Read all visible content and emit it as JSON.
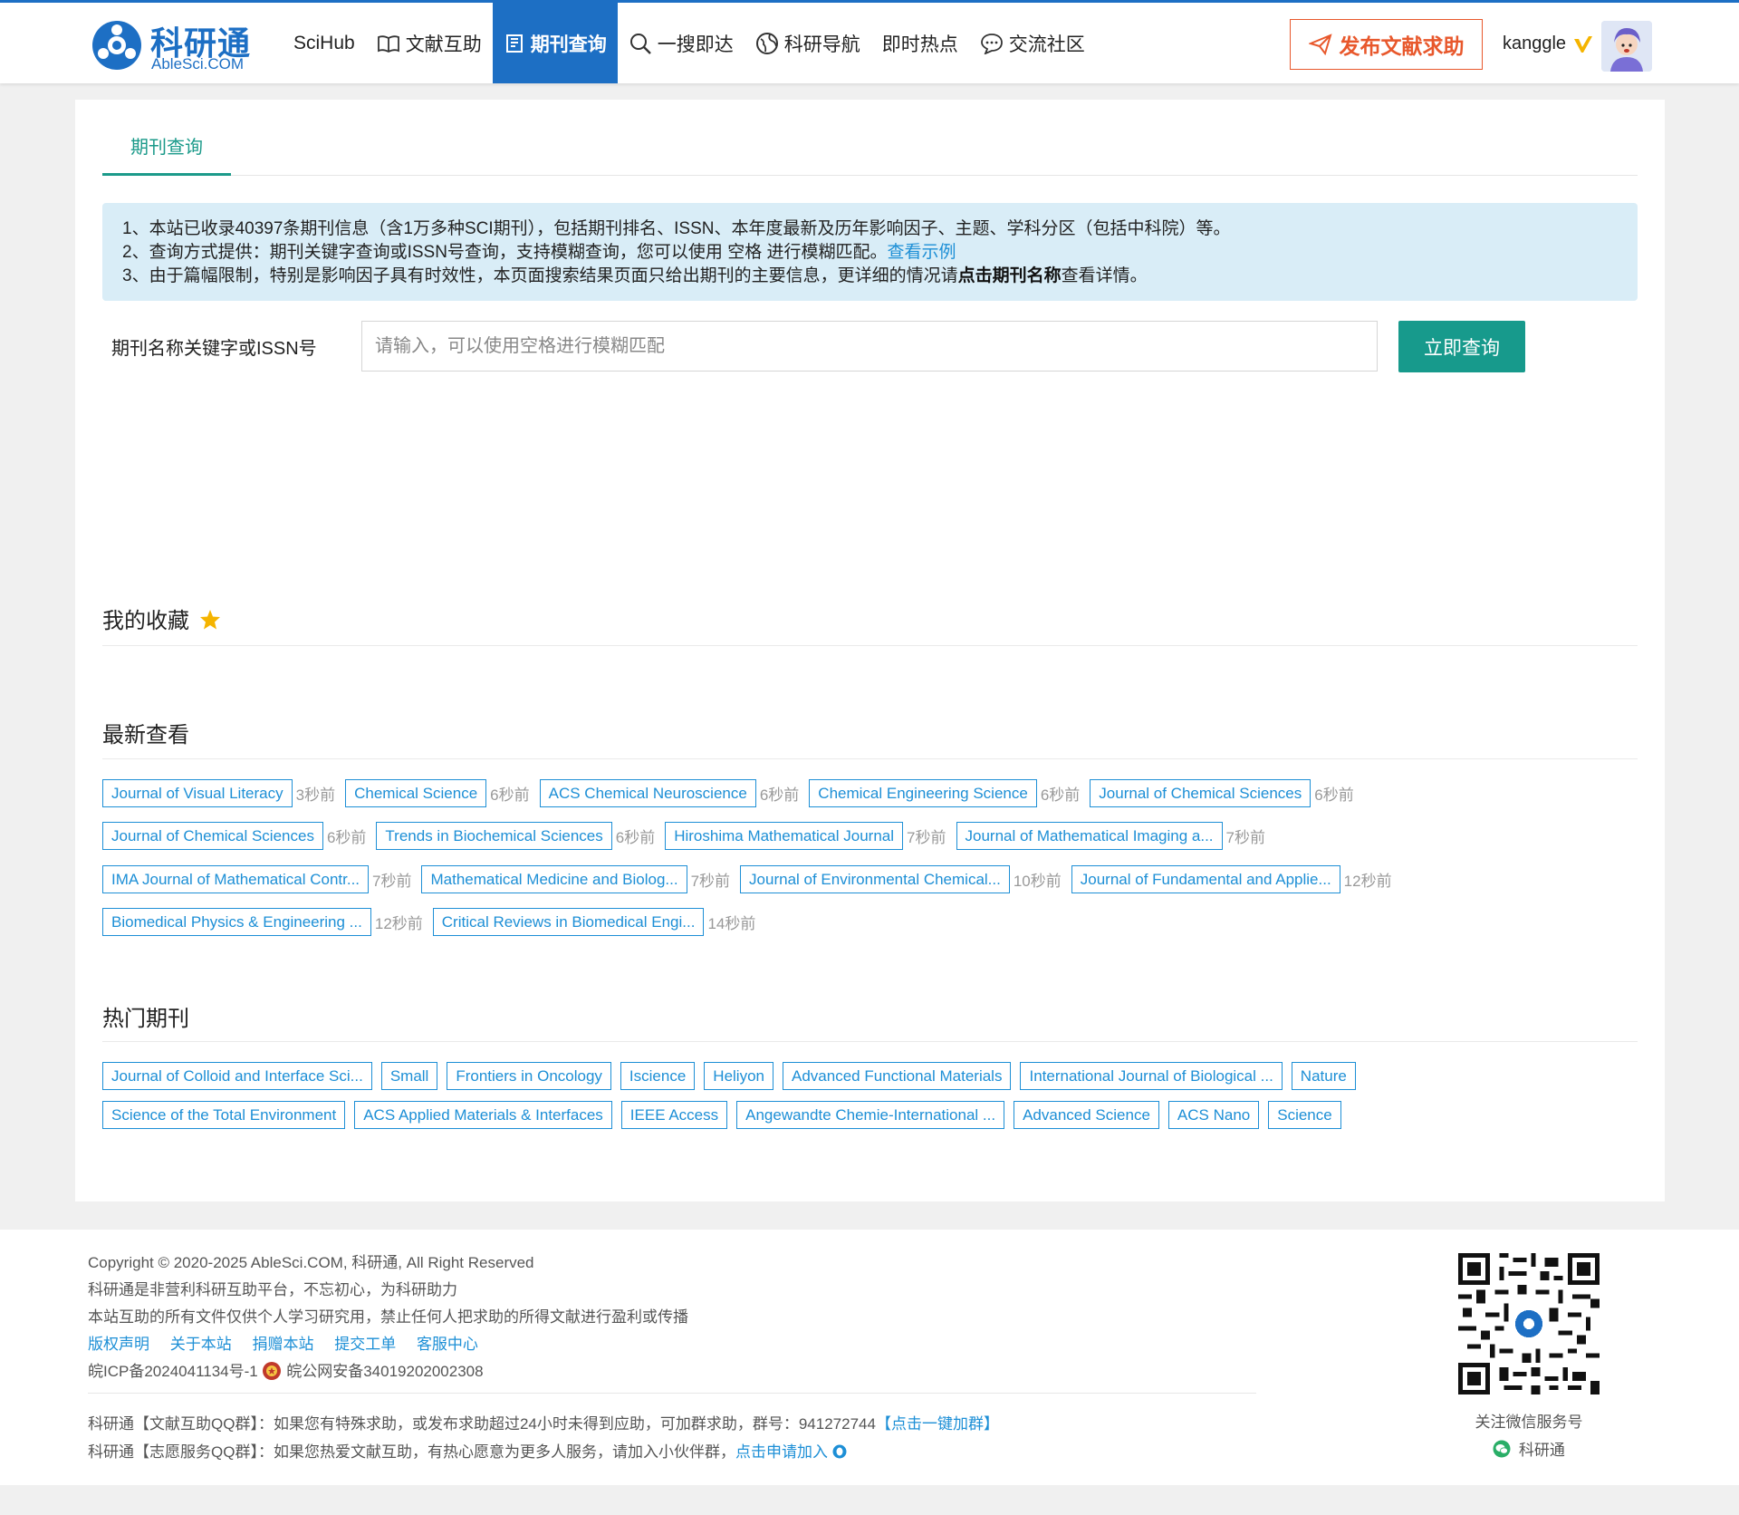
{
  "header": {
    "logo_cn": "科研通",
    "logo_en": "AbleSci.COM",
    "nav": [
      {
        "label": "SciHub",
        "icon": ""
      },
      {
        "label": "文献互助",
        "icon": "book-icon"
      },
      {
        "label": "期刊查询",
        "icon": "journal-icon",
        "active": true
      },
      {
        "label": "一搜即达",
        "icon": "search-icon"
      },
      {
        "label": "科研导航",
        "icon": "globe-icon"
      },
      {
        "label": "即时热点",
        "icon": ""
      },
      {
        "label": "交流社区",
        "icon": "chat-icon"
      }
    ],
    "post_button": "发布文献求助",
    "username": "kanggle"
  },
  "main": {
    "tab_label": "期刊查询",
    "notice": {
      "line1": "1、本站已收录40397条期刊信息（含1万多种SCI期刊），包括期刊排名、ISSN、本年度最新及历年影响因子、主题、学科分区（包括中科院）等。",
      "line2_text": "2、查询方式提供：期刊关键字查询或ISSN号查询，支持模糊查询，您可以使用 空格 进行模糊匹配。",
      "line2_link": "查看示例",
      "line3_text": "3、由于篇幅限制，特别是影响因子具有时效性，本页面搜索结果页面只给出期刊的主要信息，更详细的情况请",
      "line3_bold": "点击期刊名称",
      "line3_tail": "查看详情。"
    },
    "search": {
      "label": "期刊名称关键字或ISSN号",
      "placeholder": "请输入，可以使用空格进行模糊匹配",
      "button": "立即查询"
    },
    "favorites_title": "我的收藏",
    "recent_title": "最新查看",
    "recent": [
      [
        {
          "name": "Journal of Visual Literacy",
          "time": "3秒前"
        },
        {
          "name": "Chemical Science",
          "time": "6秒前"
        },
        {
          "name": "ACS Chemical Neuroscience",
          "time": "6秒前"
        },
        {
          "name": "Chemical Engineering Science",
          "time": "6秒前"
        },
        {
          "name": "Journal of Chemical Sciences",
          "time": "6秒前"
        }
      ],
      [
        {
          "name": "Journal of Chemical Sciences",
          "time": "6秒前"
        },
        {
          "name": "Trends in Biochemical Sciences",
          "time": "6秒前"
        },
        {
          "name": "Hiroshima Mathematical Journal",
          "time": "7秒前"
        },
        {
          "name": "Journal of Mathematical Imaging a...",
          "time": "7秒前"
        }
      ],
      [
        {
          "name": "IMA Journal of Mathematical Contr...",
          "time": "7秒前"
        },
        {
          "name": "Mathematical Medicine and Biolog...",
          "time": "7秒前"
        },
        {
          "name": "Journal of Environmental Chemical...",
          "time": "10秒前"
        },
        {
          "name": "Journal of Fundamental and Applie...",
          "time": "12秒前"
        }
      ],
      [
        {
          "name": "Biomedical Physics & Engineering ...",
          "time": "12秒前"
        },
        {
          "name": "Critical Reviews in Biomedical Engi...",
          "time": "14秒前"
        }
      ]
    ],
    "hot_title": "热门期刊",
    "hot": [
      [
        "Journal of Colloid and Interface Sci...",
        "Small",
        "Frontiers in Oncology",
        "Iscience",
        "Heliyon",
        "Advanced Functional Materials",
        "International Journal of Biological ...",
        "Nature"
      ],
      [
        "Science of the Total Environment",
        "ACS Applied Materials & Interfaces",
        "IEEE Access",
        "Angewandte Chemie-International ...",
        "Advanced Science",
        "ACS Nano",
        "Science"
      ]
    ]
  },
  "footer": {
    "copyright": "Copyright © 2020-2025 AbleSci.COM, 科研通, All Right Reserved",
    "slogan": "科研通是非营利科研互助平台，不忘初心，为科研助力",
    "disclaimer": "本站互助的所有文件仅供个人学习研究用，禁止任何人把求助的所得文献进行盈利或传播",
    "links": [
      "版权声明",
      "关于本站",
      "捐赠本站",
      "提交工单",
      "客服中心"
    ],
    "icp": "皖ICP备2024041134号-1",
    "police": "皖公网安备34019202002308",
    "qq1_text": "科研通【文献互助QQ群】：如果您有特殊求助，或发布求助超过24小时未得到应助，可加群求助，群号：941272744",
    "qq1_link": "【点击一键加群】",
    "qq2_text": "科研通【志愿服务QQ群】：如果您热爱文献互助，有热心愿意为更多人服务，请加入小伙伴群，",
    "qq2_link": "点击申请加入",
    "qr_caption": "关注微信服务号",
    "qr_name": "科研通"
  },
  "colors": {
    "brand": "#1d6fc4",
    "accent": "#179a8c",
    "link": "#1d8fd6",
    "alert": "#e8582c"
  }
}
